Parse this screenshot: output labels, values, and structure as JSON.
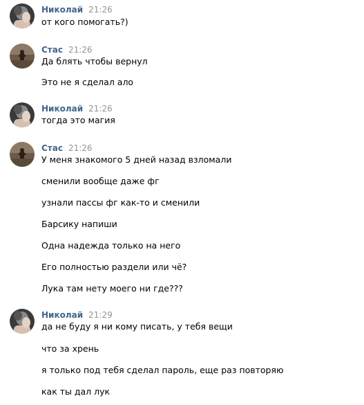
{
  "chat": {
    "groups": [
      {
        "author": "Николай",
        "time": "21:26",
        "avatar_icon": "user-avatar-nikolay",
        "messages": [
          "от кого помогать?)"
        ]
      },
      {
        "author": "Стас",
        "time": "21:26",
        "avatar_icon": "user-avatar-stas",
        "messages": [
          "Да блять чтобы вернул",
          "Это не я сделал ало"
        ]
      },
      {
        "author": "Николай",
        "time": "21:26",
        "avatar_icon": "user-avatar-nikolay",
        "messages": [
          "тогда это магия"
        ]
      },
      {
        "author": "Стас",
        "time": "21:26",
        "avatar_icon": "user-avatar-stas",
        "messages": [
          "У меня знакомого 5 дней назад взломали",
          "сменили вообще даже фг",
          "узнали пассы фг как-то и сменили",
          "Барсику напиши",
          "Одна надежда только на него",
          "Его полностью раздели или чё?",
          "Лука там нету моего ни где???"
        ]
      },
      {
        "author": "Николай",
        "time": "21:29",
        "avatar_icon": "user-avatar-nikolay",
        "messages": [
          "да не буду я ни кому писать, у тебя вещи",
          "что за хрень",
          "я только под тебя сделал пароль, еще раз повторяю",
          "как ты дал лук"
        ]
      }
    ],
    "colors": {
      "author": "#42648b",
      "time": "#939393",
      "text": "#000000",
      "background": "#ffffff"
    }
  }
}
